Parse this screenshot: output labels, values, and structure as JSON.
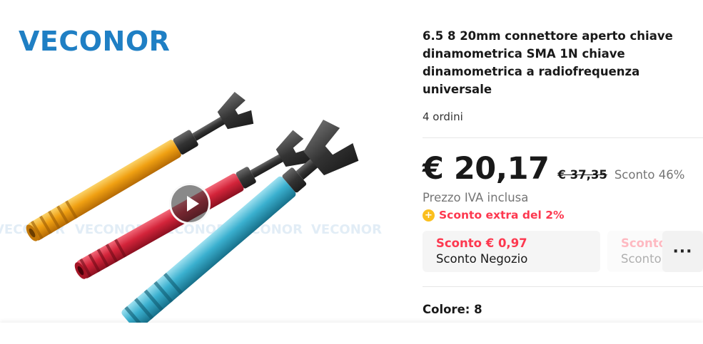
{
  "brand": {
    "logo_text": "VECONOR",
    "reg_mark": "®",
    "watermark_text": "VECONOR"
  },
  "product": {
    "title": "6.5 8 20mm connettore aperto chiave dinamometrica SMA 1N chiave dinamometrica a radiofrequenza universale",
    "orders": "4 ordini"
  },
  "price": {
    "current": "€ 20,17",
    "original": "€ 37,35",
    "discount": "Sconto 46%",
    "vat_note": "Prezzo IVA inclusa"
  },
  "extra_discount": {
    "icon": "coin-icon",
    "icon_glyph": "+",
    "label": "Sconto extra del 2%"
  },
  "coupons": [
    {
      "value": "Sconto € 0,97",
      "label": "Sconto Negozio"
    },
    {
      "value": "Sconto",
      "label": "Sconto"
    }
  ],
  "more_button": {
    "label": "···"
  },
  "color_selector": {
    "label": "Colore: 8"
  },
  "colors": {
    "accent_red": "#fd384f",
    "brand_blue": "#1f7fc4",
    "coin_yellow": "#fbbf1e",
    "wrench_orange": "#f0a012",
    "wrench_red": "#d3243a",
    "wrench_cyan": "#3ab0cf"
  }
}
